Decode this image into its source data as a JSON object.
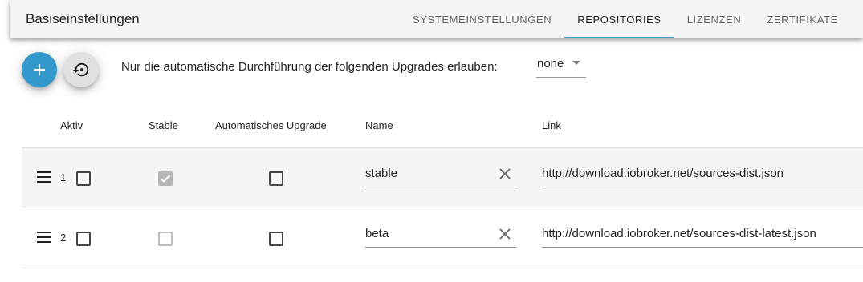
{
  "app": {
    "title": "Basiseinstellungen"
  },
  "tabs": [
    {
      "label": "SYSTEMEINSTELLUNGEN",
      "active": false
    },
    {
      "label": "REPOSITORIES",
      "active": true
    },
    {
      "label": "LIZENZEN",
      "active": false
    },
    {
      "label": "ZERTIFIKATE",
      "active": false
    }
  ],
  "toolbar": {
    "add_icon": "plus-icon",
    "restore_icon": "restore-icon"
  },
  "upgrade": {
    "label": "Nur die automatische Durchführung der folgenden Upgrades erlauben:",
    "selected": "none"
  },
  "table": {
    "headers": {
      "aktiv": "Aktiv",
      "stable": "Stable",
      "auto_upgrade": "Automatisches Upgrade",
      "name": "Name",
      "link": "Link"
    },
    "rows": [
      {
        "index": "1",
        "aktiv": false,
        "stable": true,
        "auto_upgrade": false,
        "name": "stable",
        "link": "http://download.iobroker.net/sources-dist.json"
      },
      {
        "index": "2",
        "aktiv": false,
        "stable": false,
        "auto_upgrade": false,
        "name": "beta",
        "link": "http://download.iobroker.net/sources-dist-latest.json"
      }
    ]
  },
  "colors": {
    "accent": "#3399cc",
    "appbar_bg": "#f5f5f5",
    "row_highlight": "#f5f5f5"
  }
}
